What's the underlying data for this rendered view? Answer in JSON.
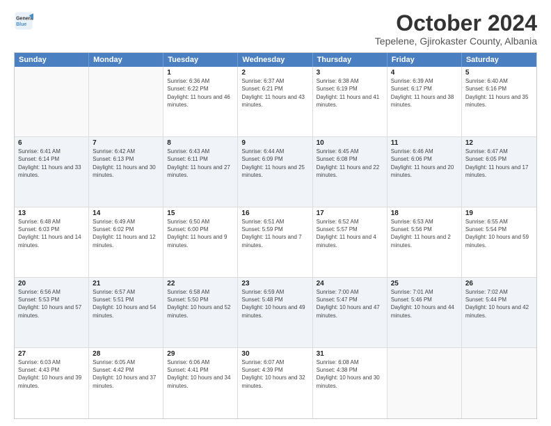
{
  "logo": {
    "line1": "General",
    "line2": "Blue"
  },
  "title": "October 2024",
  "location": "Tepelene, Gjirokaster County, Albania",
  "headers": [
    "Sunday",
    "Monday",
    "Tuesday",
    "Wednesday",
    "Thursday",
    "Friday",
    "Saturday"
  ],
  "rows": [
    [
      {
        "day": "",
        "info": "",
        "empty": true
      },
      {
        "day": "",
        "info": "",
        "empty": true
      },
      {
        "day": "1",
        "info": "Sunrise: 6:36 AM\nSunset: 6:22 PM\nDaylight: 11 hours and 46 minutes."
      },
      {
        "day": "2",
        "info": "Sunrise: 6:37 AM\nSunset: 6:21 PM\nDaylight: 11 hours and 43 minutes."
      },
      {
        "day": "3",
        "info": "Sunrise: 6:38 AM\nSunset: 6:19 PM\nDaylight: 11 hours and 41 minutes."
      },
      {
        "day": "4",
        "info": "Sunrise: 6:39 AM\nSunset: 6:17 PM\nDaylight: 11 hours and 38 minutes."
      },
      {
        "day": "5",
        "info": "Sunrise: 6:40 AM\nSunset: 6:16 PM\nDaylight: 11 hours and 35 minutes."
      }
    ],
    [
      {
        "day": "6",
        "info": "Sunrise: 6:41 AM\nSunset: 6:14 PM\nDaylight: 11 hours and 33 minutes."
      },
      {
        "day": "7",
        "info": "Sunrise: 6:42 AM\nSunset: 6:13 PM\nDaylight: 11 hours and 30 minutes."
      },
      {
        "day": "8",
        "info": "Sunrise: 6:43 AM\nSunset: 6:11 PM\nDaylight: 11 hours and 27 minutes."
      },
      {
        "day": "9",
        "info": "Sunrise: 6:44 AM\nSunset: 6:09 PM\nDaylight: 11 hours and 25 minutes."
      },
      {
        "day": "10",
        "info": "Sunrise: 6:45 AM\nSunset: 6:08 PM\nDaylight: 11 hours and 22 minutes."
      },
      {
        "day": "11",
        "info": "Sunrise: 6:46 AM\nSunset: 6:06 PM\nDaylight: 11 hours and 20 minutes."
      },
      {
        "day": "12",
        "info": "Sunrise: 6:47 AM\nSunset: 6:05 PM\nDaylight: 11 hours and 17 minutes."
      }
    ],
    [
      {
        "day": "13",
        "info": "Sunrise: 6:48 AM\nSunset: 6:03 PM\nDaylight: 11 hours and 14 minutes."
      },
      {
        "day": "14",
        "info": "Sunrise: 6:49 AM\nSunset: 6:02 PM\nDaylight: 11 hours and 12 minutes."
      },
      {
        "day": "15",
        "info": "Sunrise: 6:50 AM\nSunset: 6:00 PM\nDaylight: 11 hours and 9 minutes."
      },
      {
        "day": "16",
        "info": "Sunrise: 6:51 AM\nSunset: 5:59 PM\nDaylight: 11 hours and 7 minutes."
      },
      {
        "day": "17",
        "info": "Sunrise: 6:52 AM\nSunset: 5:57 PM\nDaylight: 11 hours and 4 minutes."
      },
      {
        "day": "18",
        "info": "Sunrise: 6:53 AM\nSunset: 5:56 PM\nDaylight: 11 hours and 2 minutes."
      },
      {
        "day": "19",
        "info": "Sunrise: 6:55 AM\nSunset: 5:54 PM\nDaylight: 10 hours and 59 minutes."
      }
    ],
    [
      {
        "day": "20",
        "info": "Sunrise: 6:56 AM\nSunset: 5:53 PM\nDaylight: 10 hours and 57 minutes."
      },
      {
        "day": "21",
        "info": "Sunrise: 6:57 AM\nSunset: 5:51 PM\nDaylight: 10 hours and 54 minutes."
      },
      {
        "day": "22",
        "info": "Sunrise: 6:58 AM\nSunset: 5:50 PM\nDaylight: 10 hours and 52 minutes."
      },
      {
        "day": "23",
        "info": "Sunrise: 6:59 AM\nSunset: 5:48 PM\nDaylight: 10 hours and 49 minutes."
      },
      {
        "day": "24",
        "info": "Sunrise: 7:00 AM\nSunset: 5:47 PM\nDaylight: 10 hours and 47 minutes."
      },
      {
        "day": "25",
        "info": "Sunrise: 7:01 AM\nSunset: 5:46 PM\nDaylight: 10 hours and 44 minutes."
      },
      {
        "day": "26",
        "info": "Sunrise: 7:02 AM\nSunset: 5:44 PM\nDaylight: 10 hours and 42 minutes."
      }
    ],
    [
      {
        "day": "27",
        "info": "Sunrise: 6:03 AM\nSunset: 4:43 PM\nDaylight: 10 hours and 39 minutes."
      },
      {
        "day": "28",
        "info": "Sunrise: 6:05 AM\nSunset: 4:42 PM\nDaylight: 10 hours and 37 minutes."
      },
      {
        "day": "29",
        "info": "Sunrise: 6:06 AM\nSunset: 4:41 PM\nDaylight: 10 hours and 34 minutes."
      },
      {
        "day": "30",
        "info": "Sunrise: 6:07 AM\nSunset: 4:39 PM\nDaylight: 10 hours and 32 minutes."
      },
      {
        "day": "31",
        "info": "Sunrise: 6:08 AM\nSunset: 4:38 PM\nDaylight: 10 hours and 30 minutes."
      },
      {
        "day": "",
        "info": "",
        "empty": true
      },
      {
        "day": "",
        "info": "",
        "empty": true
      }
    ]
  ]
}
